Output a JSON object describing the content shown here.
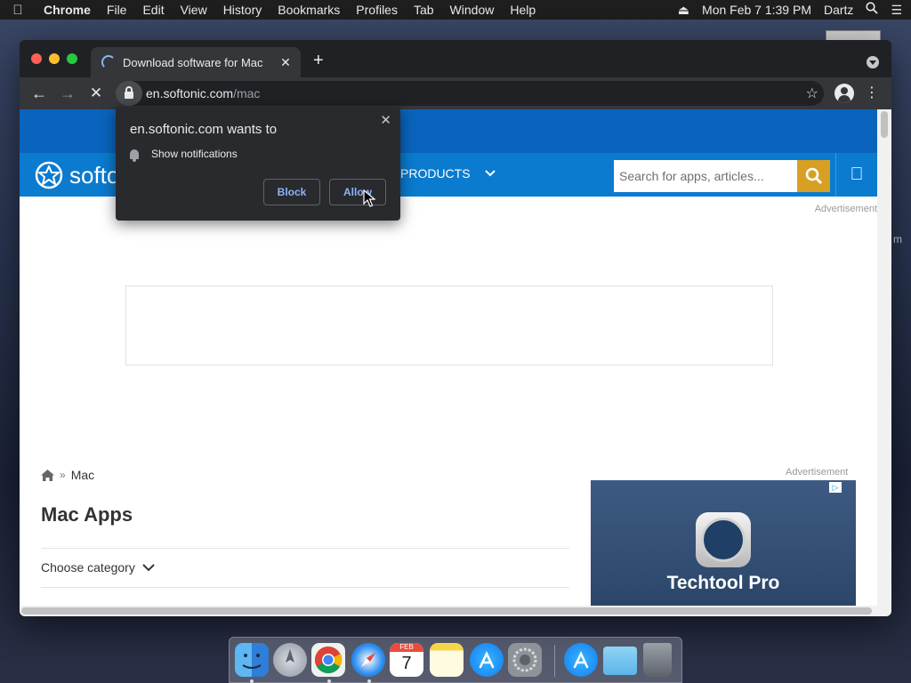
{
  "menubar": {
    "app_name": "Chrome",
    "menus": [
      "File",
      "Edit",
      "View",
      "History",
      "Bookmarks",
      "Profiles",
      "Tab",
      "Window",
      "Help"
    ],
    "datetime": "Mon Feb 7  1:39 PM",
    "user": "Dartz"
  },
  "browser": {
    "tab_title": "Download software for Mac",
    "url_host": "en.softonic.com",
    "url_path": "/mac"
  },
  "permission_popup": {
    "title": "en.softonic.com wants to",
    "permission": "Show notifications",
    "block_label": "Block",
    "allow_label": "Allow"
  },
  "site": {
    "logo_text": "softo",
    "nav_products": "PRODUCTS",
    "search_placeholder": "Search for apps, articles...",
    "advertisement_label": "Advertisement",
    "breadcrumb_current": "Mac",
    "breadcrumb_sep": "»",
    "page_title": "Mac Apps",
    "category_label": "Choose category",
    "side_ad_label": "Advertisement",
    "side_ad_title": "Techtool Pro"
  },
  "desktop": {
    "edge_letter": "m"
  },
  "dock": {
    "apps": [
      "Finder",
      "Launchpad",
      "Google Chrome",
      "Safari",
      "Calendar",
      "Notes",
      "App Store",
      "System Preferences",
      "App Store",
      "Downloads",
      "Trash"
    ],
    "calendar_month": "FEB",
    "calendar_day": "7"
  },
  "colors": {
    "softonic_blue": "#0b7bcf",
    "softonic_dark_blue": "#0a64bd",
    "search_button": "#d8a023",
    "chrome_link_blue": "#8ab4f8"
  }
}
